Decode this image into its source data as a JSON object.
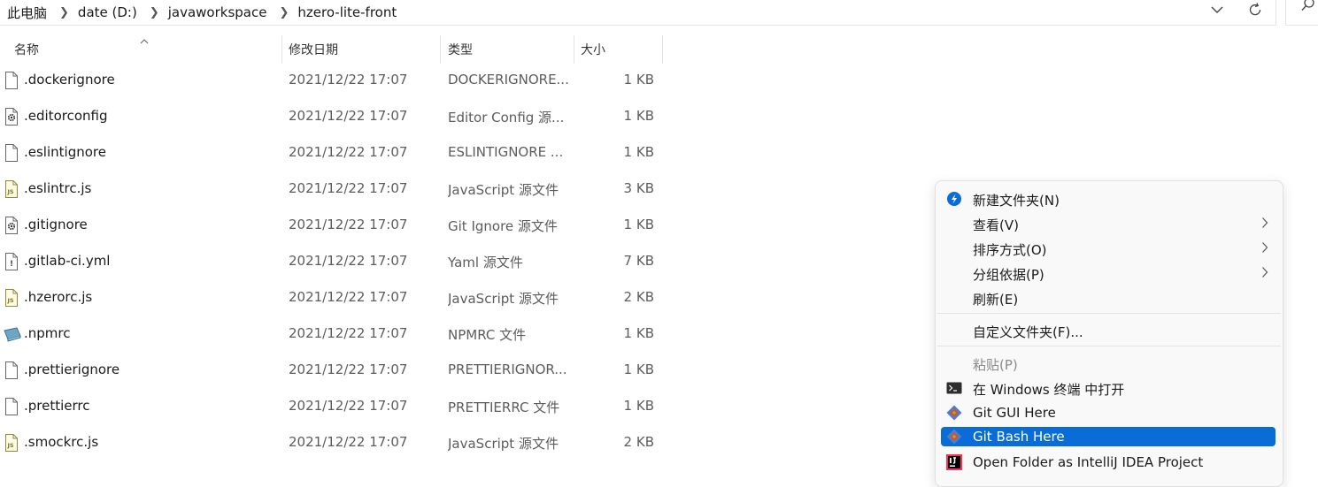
{
  "breadcrumb": [
    "此电脑",
    "date (D:)",
    "javaworkspace",
    "hzero-lite-front"
  ],
  "columns": {
    "name": "名称",
    "date": "修改日期",
    "type": "类型",
    "size": "大小"
  },
  "files": [
    {
      "name": ".dockerignore",
      "date": "2021/12/22 17:07",
      "type": "DOCKERIGNORE...",
      "size": "1 KB",
      "icon": "file-icon"
    },
    {
      "name": ".editorconfig",
      "date": "2021/12/22 17:07",
      "type": "Editor Config 源...",
      "size": "1 KB",
      "icon": "config-file-icon"
    },
    {
      "name": ".eslintignore",
      "date": "2021/12/22 17:07",
      "type": "ESLINTIGNORE ...",
      "size": "1 KB",
      "icon": "file-icon"
    },
    {
      "name": ".eslintrc.js",
      "date": "2021/12/22 17:07",
      "type": "JavaScript 源文件",
      "size": "3 KB",
      "icon": "js-file-icon"
    },
    {
      "name": ".gitignore",
      "date": "2021/12/22 17:07",
      "type": "Git Ignore 源文件",
      "size": "1 KB",
      "icon": "config-file-icon"
    },
    {
      "name": ".gitlab-ci.yml",
      "date": "2021/12/22 17:07",
      "type": "Yaml 源文件",
      "size": "7 KB",
      "icon": "yaml-file-icon"
    },
    {
      "name": ".hzerorc.js",
      "date": "2021/12/22 17:07",
      "type": "JavaScript 源文件",
      "size": "2 KB",
      "icon": "js-file-icon"
    },
    {
      "name": ".npmrc",
      "date": "2021/12/22 17:07",
      "type": "NPMRC 文件",
      "size": "1 KB",
      "icon": "npmrc-file-icon"
    },
    {
      "name": ".prettierignore",
      "date": "2021/12/22 17:07",
      "type": "PRETTIERIGNOR...",
      "size": "1 KB",
      "icon": "file-icon"
    },
    {
      "name": ".prettierrc",
      "date": "2021/12/22 17:07",
      "type": "PRETTIERRC 文件",
      "size": "1 KB",
      "icon": "file-icon"
    },
    {
      "name": ".smockrc.js",
      "date": "2021/12/22 17:07",
      "type": "JavaScript 源文件",
      "size": "2 KB",
      "icon": "js-file-icon"
    }
  ],
  "context_menu": {
    "new_folder": "新建文件夹(N)",
    "view": "查看(V)",
    "sort_by": "排序方式(O)",
    "group_by": "分组依据(P)",
    "refresh": "刷新(E)",
    "customize": "自定义文件夹(F)...",
    "paste": "粘贴(P)",
    "open_terminal": "在 Windows 终端 中打开",
    "git_gui": "Git GUI Here",
    "git_bash": "Git Bash Here",
    "open_idea": "Open Folder as IntelliJ IDEA Project"
  },
  "colors": {
    "highlight": "#0a6cd6",
    "accent": "#0078d4"
  }
}
